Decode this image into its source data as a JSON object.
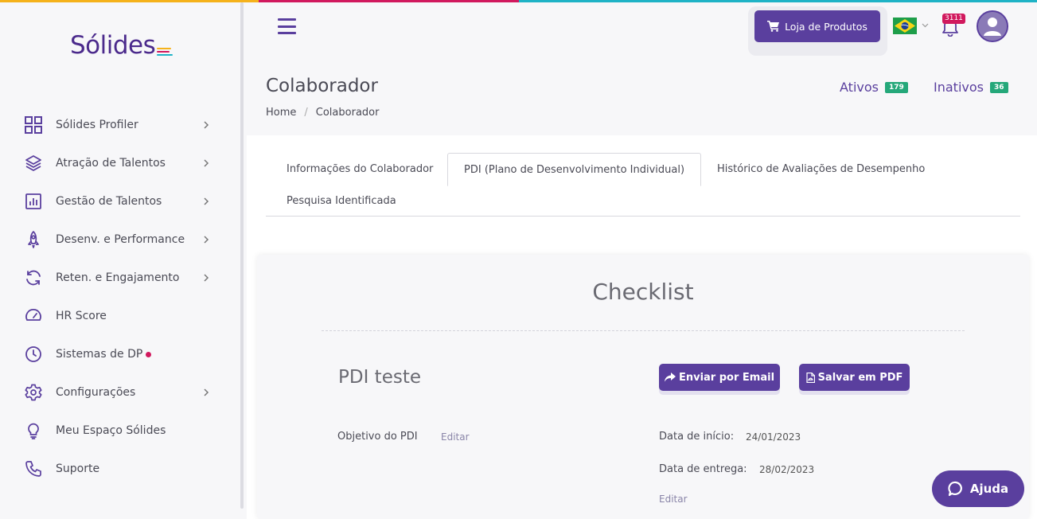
{
  "brand": {
    "logo_text": "Sólides",
    "stripe_colors": [
      "#f5b21b",
      "#d1195e",
      "#1fb3c6"
    ],
    "accent": "#5a3f9e",
    "success": "#25a87a"
  },
  "sidebar": {
    "items": [
      {
        "label": "Sólides Profiler",
        "icon": "grid-icon",
        "has_submenu": true
      },
      {
        "label": "Atração de Talentos",
        "icon": "layers-icon",
        "has_submenu": true
      },
      {
        "label": "Gestão de Talentos",
        "icon": "bar-chart-icon",
        "has_submenu": true
      },
      {
        "label": "Desenv. e Performance",
        "icon": "rocket-icon",
        "has_submenu": true
      },
      {
        "label": "Reten. e Engajamento",
        "icon": "refresh-icon",
        "has_submenu": true
      },
      {
        "label": "HR Score",
        "icon": "gauge-icon",
        "has_submenu": false
      },
      {
        "label": "Sistemas de DP",
        "icon": "clock-icon",
        "has_submenu": false
      },
      {
        "label": "Configurações",
        "icon": "gear-icon",
        "has_submenu": true
      },
      {
        "label": "Meu Espaço Sólides",
        "icon": "lightbulb-icon",
        "has_submenu": false
      },
      {
        "label": "Suporte",
        "icon": "phone-icon",
        "has_submenu": false
      }
    ]
  },
  "header": {
    "shop_label": "Loja de Produtos",
    "notification_count": "3111",
    "language": "flag-brazil"
  },
  "page": {
    "title": "Colaborador",
    "breadcrumb": [
      "Home",
      "Colaborador"
    ],
    "status": {
      "active_label": "Ativos",
      "active_count": "179",
      "inactive_label": "Inativos",
      "inactive_count": "36"
    }
  },
  "tabs": [
    {
      "label": "Informações do Colaborador",
      "active": false
    },
    {
      "label": "PDI (Plano de Desenvolvimento Individual)",
      "active": true
    },
    {
      "label": "Histórico de Avaliações de Desempenho",
      "active": false
    },
    {
      "label": "Pesquisa Identificada",
      "active": false
    }
  ],
  "checklist": {
    "title": "Checklist",
    "pdi_name": "PDI teste",
    "email_button": "Enviar por Email",
    "pdf_button": "Salvar em PDF",
    "objective_label": "Objetivo do PDI",
    "edit_label": "Editar",
    "start_label": "Data de início:",
    "start_value": "24/01/2023",
    "due_label": "Data de entrega:",
    "due_value": "28/02/2023"
  },
  "help": {
    "label": "Ajuda"
  }
}
